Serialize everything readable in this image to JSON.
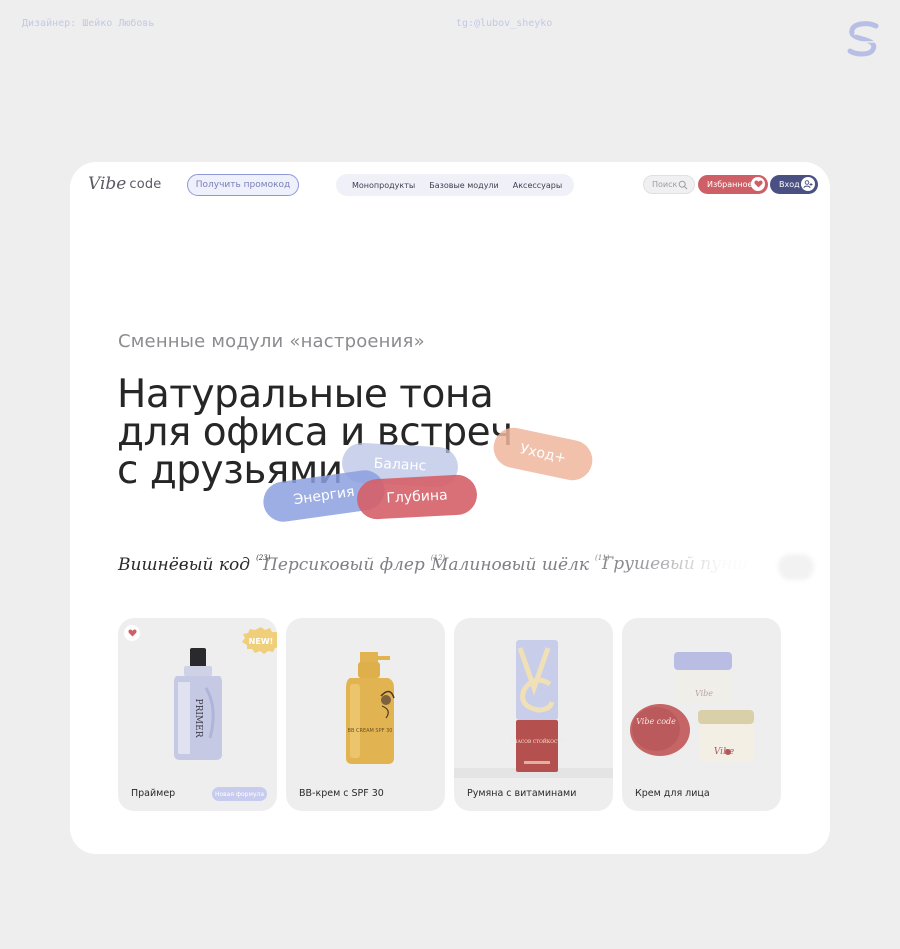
{
  "meta": {
    "author": "Дизайнер: Шейко Любовь",
    "telegram": "tg:@lubov_sheyko"
  },
  "nav": {
    "logo_vibe": "Vibe",
    "logo_code": "code",
    "promo_label": "Получить промокод",
    "menu": [
      "Монопродукты",
      "Базовые модули",
      "Аксессуары"
    ],
    "search_placeholder": "Поиск",
    "favorites_label": "Избранное",
    "login_label": "Вход"
  },
  "hero": {
    "subtitle": "Сменные модули «настроения»",
    "headline_line1": "Натуральные тона",
    "headline_line2": "для офиса и встреч",
    "headline_line3": "с друзьями",
    "pills": {
      "energy": "Энергия",
      "balance": "Баланс",
      "care": "Уход+",
      "depth": "Глубина"
    }
  },
  "tones": [
    {
      "name": "Вишнёвый код",
      "count": "(23)"
    },
    {
      "name": "Персиковый флер",
      "count": "(12)"
    },
    {
      "name": "Малиновый шёлк",
      "count": "(11)"
    },
    {
      "name": "Грушевый пунш",
      "count": ""
    }
  ],
  "products": [
    {
      "name": "Праймер",
      "tag": "Новая формула",
      "badge": "NEW!",
      "label_text": "PRIMER"
    },
    {
      "name": "ВВ-крем с SPF 30",
      "label_text": "BB CREAM SPF 30"
    },
    {
      "name": "Румяна с витаминами",
      "label_text": "8 ЧАСОВ СТОЙКОСТИ"
    },
    {
      "name": "Крем для лица",
      "label_text": "Vibe code"
    }
  ],
  "colors": {
    "background": "#eeeeee",
    "card": "#ffffff",
    "accent_red": "#cf5f66",
    "accent_navy": "#4b5083",
    "accent_lavender": "#8f97d6"
  }
}
